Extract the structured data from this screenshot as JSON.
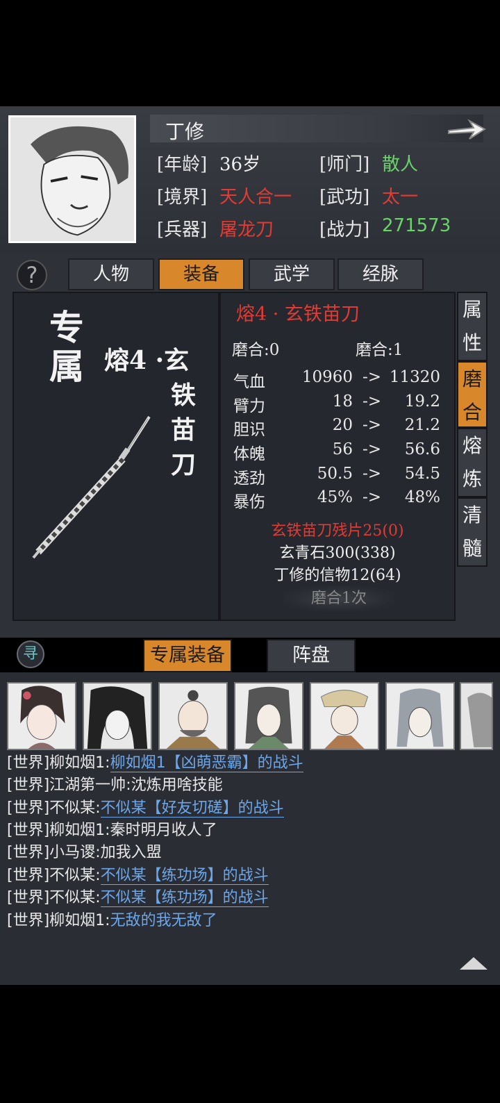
{
  "character": {
    "name": "丁修",
    "age_label": "[年龄]",
    "age_value": "36岁",
    "sect_label": "[师门]",
    "sect_value": "散人",
    "realm_label": "[境界]",
    "realm_value": "天人合一",
    "martial_label": "[武功]",
    "martial_value": "太一",
    "weapon_label": "[兵器]",
    "weapon_value": "屠龙刀",
    "power_label": "[战力]",
    "power_value": "271573"
  },
  "top_tabs": [
    "人物",
    "装备",
    "武学",
    "经脉"
  ],
  "active_top_tab": "装备",
  "equipment": {
    "exclusive_label": "专属",
    "weapon_name_vertical": [
      "熔4 ·玄",
      "铁",
      "苗",
      "刀"
    ],
    "title": "熔4 · 玄铁苗刀",
    "mohe_current": "磨合:0",
    "mohe_next": "磨合:1",
    "attributes": [
      {
        "name": "气血",
        "from": "10960",
        "arrow": "->",
        "to": "11320"
      },
      {
        "name": "臂力",
        "from": "18",
        "arrow": "->",
        "to": "19.2"
      },
      {
        "name": "胆识",
        "from": "20",
        "arrow": "->",
        "to": "21.2"
      },
      {
        "name": "体魄",
        "from": "56",
        "arrow": "->",
        "to": "56.6"
      },
      {
        "name": "透劲",
        "from": "50.5",
        "arrow": "->",
        "to": "54.5"
      },
      {
        "name": "暴伤",
        "from": "45%",
        "arrow": "->",
        "to": "48%"
      }
    ],
    "materials": [
      {
        "text": "玄铁苗刀残片25(0)",
        "color": "#e23b33"
      },
      {
        "text": "玄青石300(338)",
        "color": "#f0f0f0"
      },
      {
        "text": "丁修的信物12(64)",
        "color": "#f0f0f0"
      }
    ],
    "temper_button": "磨合1次"
  },
  "side_tabs": [
    {
      "chars": [
        "属",
        "性"
      ],
      "active": false
    },
    {
      "chars": [
        "磨",
        "合"
      ],
      "active": true
    },
    {
      "chars": [
        "熔",
        "炼"
      ],
      "active": false
    },
    {
      "chars": [
        "清",
        "髓"
      ],
      "active": false
    }
  ],
  "seek_icon_text": "寻",
  "bottom_tabs": [
    "专属装备",
    "阵盘"
  ],
  "active_bottom_tab": "专属装备",
  "chat": [
    {
      "channel": "[世界]",
      "sender": "柳如烟1",
      "plain": "",
      "link": "柳如烟1【凶萌恶霸】的战斗"
    },
    {
      "channel": "[世界]",
      "sender": "江湖第一帅",
      "plain": "沈炼用啥技能",
      "link": ""
    },
    {
      "channel": "[世界]",
      "sender": "不似某",
      "plain": "",
      "link": "不似某【好友切磋】的战斗"
    },
    {
      "channel": "[世界]",
      "sender": "柳如烟1",
      "plain": "秦时明月收人了",
      "link": ""
    },
    {
      "channel": "[世界]",
      "sender": "小马谡",
      "plain": "加我入盟",
      "link": ""
    },
    {
      "channel": "[世界]",
      "sender": "不似某",
      "plain": "",
      "link": "不似某【练功场】的战斗"
    },
    {
      "channel": "[世界]",
      "sender": "不似某",
      "plain": "",
      "link": "不似某【练功场】的战斗"
    },
    {
      "channel": "[世界]",
      "sender": "柳如烟1",
      "plain": "",
      "link": "无敌的我无敌了"
    }
  ],
  "colors": {
    "accent": "#d8882a",
    "red_text": "#e23b33",
    "green_text": "#6ad46a",
    "link_blue": "#6ba7ea"
  }
}
